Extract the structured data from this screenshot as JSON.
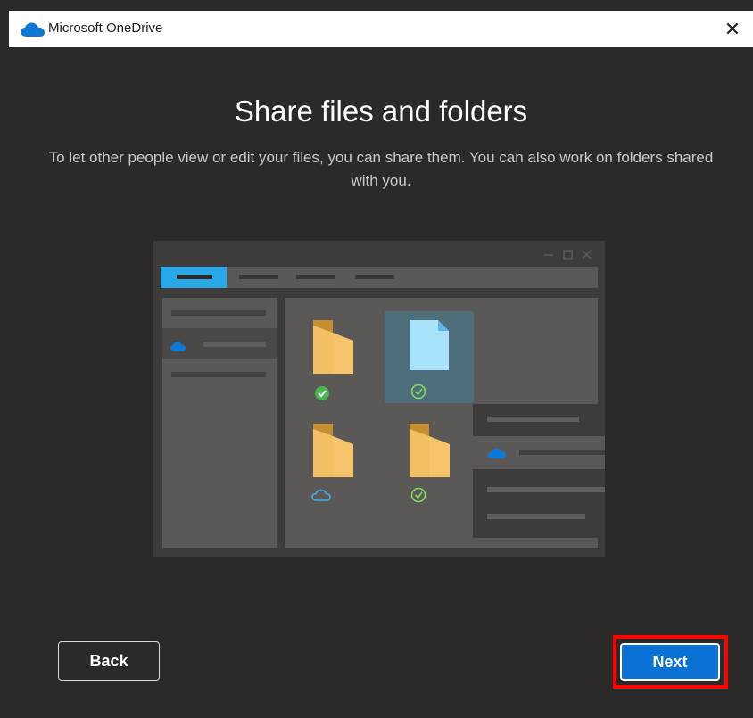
{
  "window": {
    "title": "Microsoft OneDrive",
    "close_glyph": "✕"
  },
  "content": {
    "heading": "Share files and folders",
    "subtitle": "To let other people view or edit your files, you can share them. You can also work on folders shared with you."
  },
  "buttons": {
    "back_label": "Back",
    "next_label": "Next"
  },
  "colors": {
    "background": "#2b2a29",
    "accent": "#0a72d5",
    "highlight_border": "#ff0000",
    "onedrive_blue": "#0f78d4"
  },
  "illustration": {
    "icons": [
      "onedrive-cloud-icon",
      "folder-icon",
      "file-icon",
      "synced-check-icon",
      "cloud-only-icon",
      "cursor-icon"
    ]
  }
}
